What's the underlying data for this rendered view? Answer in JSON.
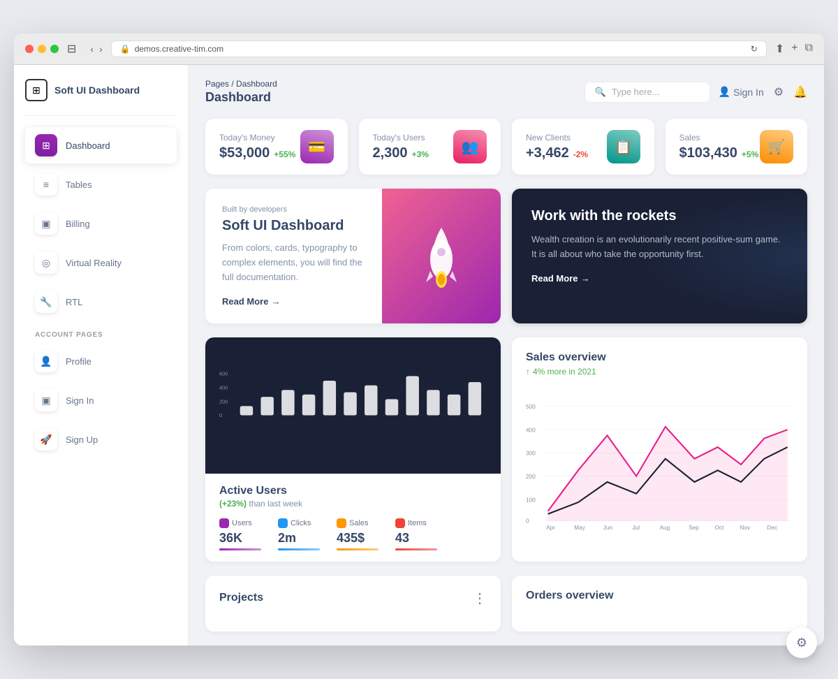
{
  "browser": {
    "url": "demos.creative-tim.com",
    "lock_icon": "🔒"
  },
  "sidebar": {
    "brand_name": "Soft UI Dashboard",
    "nav_items": [
      {
        "id": "dashboard",
        "label": "Dashboard",
        "icon": "⊞",
        "active": true
      },
      {
        "id": "tables",
        "label": "Tables",
        "icon": "≡",
        "active": false
      },
      {
        "id": "billing",
        "label": "Billing",
        "icon": "💳",
        "active": false
      },
      {
        "id": "virtual-reality",
        "label": "Virtual Reality",
        "icon": "👓",
        "active": false
      },
      {
        "id": "rtl",
        "label": "RTL",
        "icon": "🔧",
        "active": false
      }
    ],
    "account_section_label": "ACCOUNT PAGES",
    "account_items": [
      {
        "id": "profile",
        "label": "Profile",
        "icon": "👤",
        "active": false
      },
      {
        "id": "sign-in",
        "label": "Sign In",
        "icon": "🔲",
        "active": false
      },
      {
        "id": "sign-up",
        "label": "Sign Up",
        "icon": "🚀",
        "active": false
      }
    ]
  },
  "header": {
    "breadcrumb_pages": "Pages",
    "breadcrumb_separator": "/",
    "breadcrumb_current": "Dashboard",
    "title": "Dashboard",
    "search_placeholder": "Type here...",
    "sign_in_label": "Sign In",
    "settings_icon": "⚙",
    "notifications_icon": "🔔"
  },
  "stats": [
    {
      "id": "money",
      "label": "Today's Money",
      "value": "$53,000",
      "change": "+55%",
      "change_type": "up",
      "icon": "💳",
      "icon_class": "purple"
    },
    {
      "id": "users",
      "label": "Today's Users",
      "value": "2,300",
      "change": "+3%",
      "change_type": "up",
      "icon": "👥",
      "icon_class": "pink"
    },
    {
      "id": "clients",
      "label": "New Clients",
      "value": "+3,462",
      "change": "-2%",
      "change_type": "down",
      "icon": "📋",
      "icon_class": "teal"
    },
    {
      "id": "sales",
      "label": "Sales",
      "value": "$103,430",
      "change": "+5%",
      "change_type": "up",
      "icon": "🛒",
      "icon_class": "orange"
    }
  ],
  "promo": {
    "label": "Built by developers",
    "title": "Soft UI Dashboard",
    "description": "From colors, cards, typography to complex elements, you will find the full documentation.",
    "read_more": "Read More"
  },
  "dark_card": {
    "title": "Work with the rockets",
    "description": "Wealth creation is an evolutionarily recent positive-sum game. It is all about who take the opportunity first.",
    "read_more": "Read More"
  },
  "active_users": {
    "title": "Active Users",
    "subtitle_prefix": "(+23%)",
    "subtitle_suffix": "than last week",
    "stats": [
      {
        "id": "users",
        "label": "Users",
        "value": "36K",
        "icon_class": "purple"
      },
      {
        "id": "clicks",
        "label": "Clicks",
        "value": "2m",
        "icon_class": "blue"
      },
      {
        "id": "sales",
        "label": "Sales",
        "value": "435$",
        "icon_class": "orange"
      },
      {
        "id": "items",
        "label": "Items",
        "value": "43",
        "icon_class": "red"
      }
    ],
    "bar_data": [
      30,
      50,
      70,
      55,
      90,
      65,
      80,
      45,
      95,
      70,
      60,
      85
    ]
  },
  "sales_overview": {
    "title": "Sales overview",
    "subtitle": "4% more in 2021",
    "y_labels": [
      "500",
      "400",
      "300",
      "200",
      "100",
      "0"
    ],
    "x_labels": [
      "Apr",
      "May",
      "Jun",
      "Jul",
      "Aug",
      "Sep",
      "Oct",
      "Nov",
      "Dec"
    ]
  },
  "projects": {
    "title": "Projects"
  },
  "orders": {
    "title": "Orders overview"
  },
  "settings_fab": "⚙"
}
